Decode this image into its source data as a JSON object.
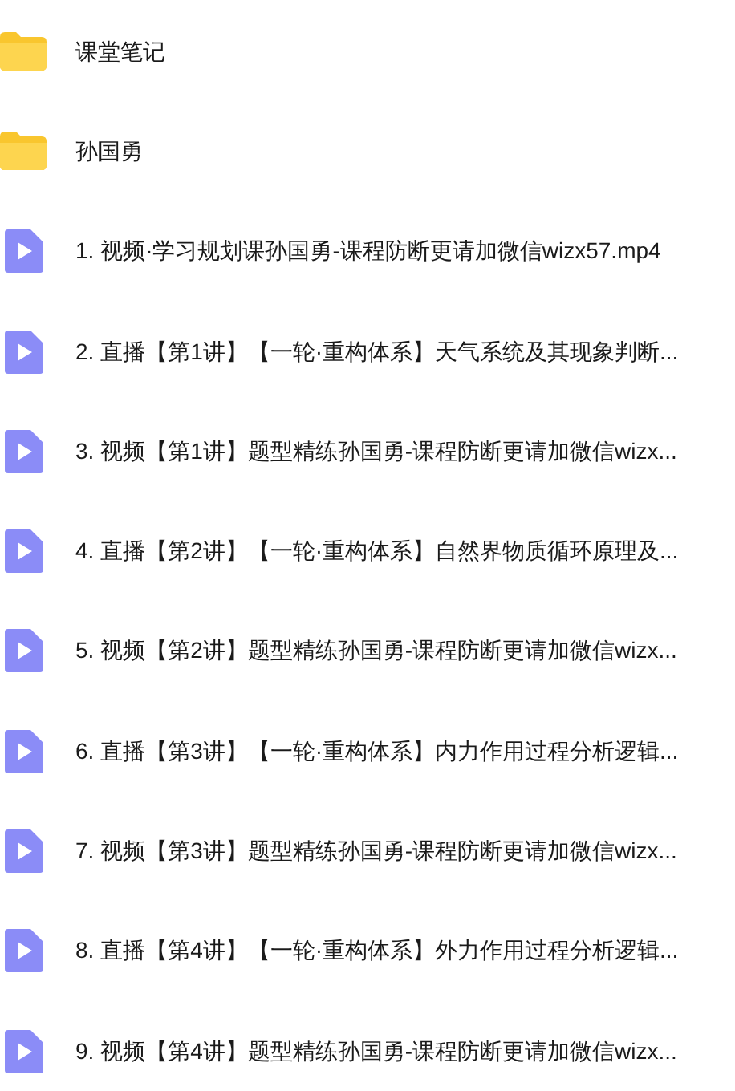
{
  "files": [
    {
      "kind": "folder",
      "name": "课堂笔记"
    },
    {
      "kind": "folder",
      "name": "孙国勇"
    },
    {
      "kind": "video",
      "name": "1. 视频·学习规划课孙国勇-课程防断更请加微信wizx57.mp4"
    },
    {
      "kind": "video",
      "name": "2. 直播【第1讲】【一轮·重构体系】天气系统及其现象判断..."
    },
    {
      "kind": "video",
      "name": "3. 视频【第1讲】题型精练孙国勇-课程防断更请加微信wizx..."
    },
    {
      "kind": "video",
      "name": "4. 直播【第2讲】【一轮·重构体系】自然界物质循环原理及..."
    },
    {
      "kind": "video",
      "name": "5. 视频【第2讲】题型精练孙国勇-课程防断更请加微信wizx..."
    },
    {
      "kind": "video",
      "name": "6. 直播【第3讲】【一轮·重构体系】内力作用过程分析逻辑..."
    },
    {
      "kind": "video",
      "name": "7. 视频【第3讲】题型精练孙国勇-课程防断更请加微信wizx..."
    },
    {
      "kind": "video",
      "name": "8. 直播【第4讲】【一轮·重构体系】外力作用过程分析逻辑..."
    },
    {
      "kind": "video",
      "name": "9. 视频【第4讲】题型精练孙国勇-课程防断更请加微信wizx..."
    }
  ]
}
